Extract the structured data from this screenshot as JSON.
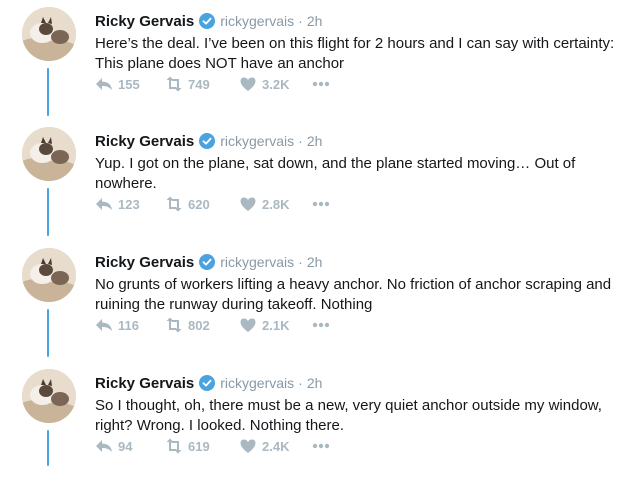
{
  "colors": {
    "thread_line": "#4aa3df",
    "verified": "#4aa3df",
    "action_gray": "#aab8c2",
    "meta_gray": "#8899a6"
  },
  "tweets": [
    {
      "name": "Ricky Gervais",
      "handle": "rickygervais",
      "dot": "·",
      "time": "2h",
      "lines": [
        "Here’s the deal. I’ve been on this flight for 2 hours and I can say with certainty:",
        "This plane does NOT have an anchor"
      ],
      "replies": "155",
      "retweets": "749",
      "likes": "3.2K"
    },
    {
      "name": "Ricky Gervais",
      "handle": "rickygervais",
      "dot": "·",
      "time": "2h",
      "lines": [
        "Yup. I got on the plane, sat down, and the plane started moving… Out of",
        "nowhere."
      ],
      "replies": "123",
      "retweets": "620",
      "likes": "2.8K"
    },
    {
      "name": "Ricky Gervais",
      "handle": "rickygervais",
      "dot": "·",
      "time": "2h",
      "lines": [
        "No grunts of workers lifting a heavy anchor. No friction of anchor scraping and",
        "ruining the runway during takeoff. Nothing"
      ],
      "replies": "116",
      "retweets": "802",
      "likes": "2.1K"
    },
    {
      "name": "Ricky Gervais",
      "handle": "rickygervais",
      "dot": "·",
      "time": "2h",
      "lines": [
        "So I thought, oh, there must be a new, very quiet anchor outside my window,",
        "right? Wrong. I looked. Nothing there."
      ],
      "replies": "94",
      "retweets": "619",
      "likes": "2.4K"
    }
  ]
}
